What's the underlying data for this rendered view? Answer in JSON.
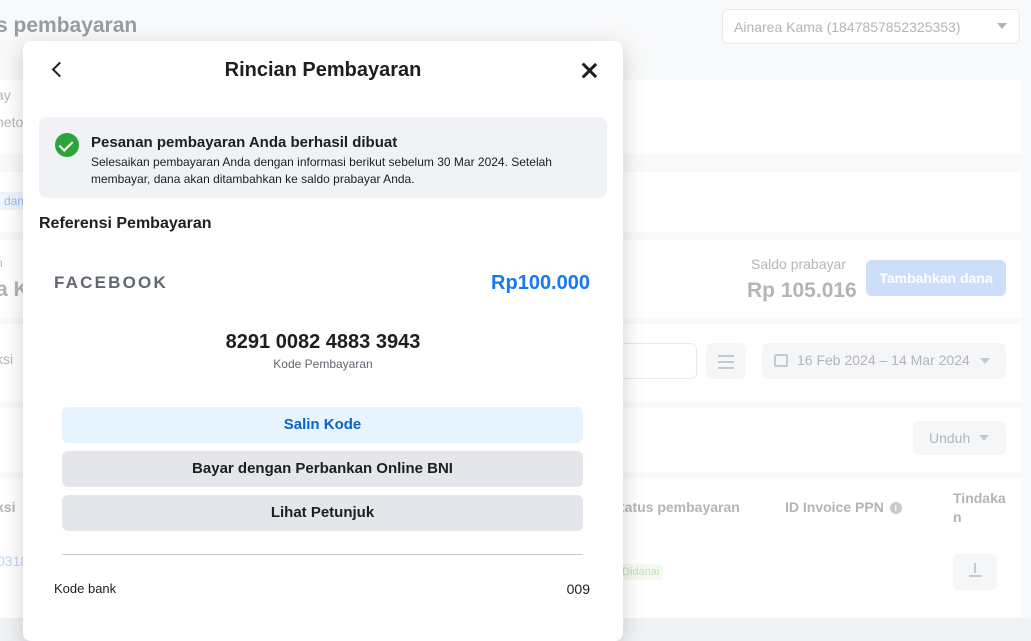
{
  "background": {
    "header_title": "s pembayaran",
    "account_selector": "Ainarea Kama (1847857852325353)",
    "side_fragments": [
      "ay",
      "neto",
      "dan",
      "n",
      "a K",
      "ksi",
      "ksi",
      "0318"
    ],
    "balance_label": "Saldo prabayar",
    "balance_value": "Rp 105.016",
    "add_funds_button": "Tambahkan dana",
    "date_range": "16 Feb 2024 – 14 Mar 2024",
    "download_button": "Unduh",
    "table_headers": {
      "payment_status": "tatus pembayaran",
      "vat_invoice_id": "ID Invoice PPN",
      "action": "Tindaka n"
    },
    "status_badge": "Didanai"
  },
  "modal": {
    "title": "Rincian Pembayaran",
    "notice": {
      "title": "Pesanan pembayaran Anda berhasil dibuat",
      "body": "Selesaikan pembayaran Anda dengan informasi berikut sebelum 30 Mar 2024. Setelah membayar, dana akan ditambahkan ke saldo prabayar Anda."
    },
    "section_title": "Referensi Pembayaran",
    "merchant": "FACEBOOK",
    "amount": "Rp100.000",
    "payment_code": "8291 0082 4883 3943",
    "payment_code_label": "Kode Pembayaran",
    "buttons": {
      "copy": "Salin Kode",
      "bank": "Bayar dengan Perbankan Online BNI",
      "guide": "Lihat Petunjuk"
    },
    "bank_code_label": "Kode bank",
    "bank_code_value": "009"
  },
  "colors": {
    "accent": "#1877f2",
    "success": "#2aa43b",
    "copy_button_bg": "#e7f3ff"
  }
}
